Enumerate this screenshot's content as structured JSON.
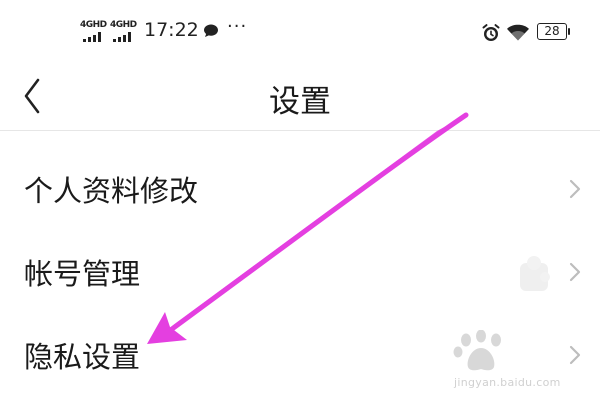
{
  "status_bar": {
    "network_1": "4GHD",
    "network_2": "4GHD",
    "time": "17:22",
    "more": "···",
    "battery": "28",
    "icons": [
      "signal-icon",
      "signal-icon",
      "chat-bubble-icon",
      "more-icon",
      "alarm-icon",
      "wifi-icon",
      "battery-icon"
    ]
  },
  "header": {
    "back_icon": "chevron-left-icon",
    "title": "设置"
  },
  "settings": {
    "items": [
      {
        "label": "个人资料修改",
        "icon": "chevron-right-icon"
      },
      {
        "label": "帐号管理",
        "icon": "chevron-right-icon"
      },
      {
        "label": "隐私设置",
        "icon": "chevron-right-icon"
      }
    ]
  },
  "annotation": {
    "color": "#e43fe0",
    "points_to": "隐私设置"
  },
  "watermark": {
    "text": "jingyan.baidu.com"
  }
}
